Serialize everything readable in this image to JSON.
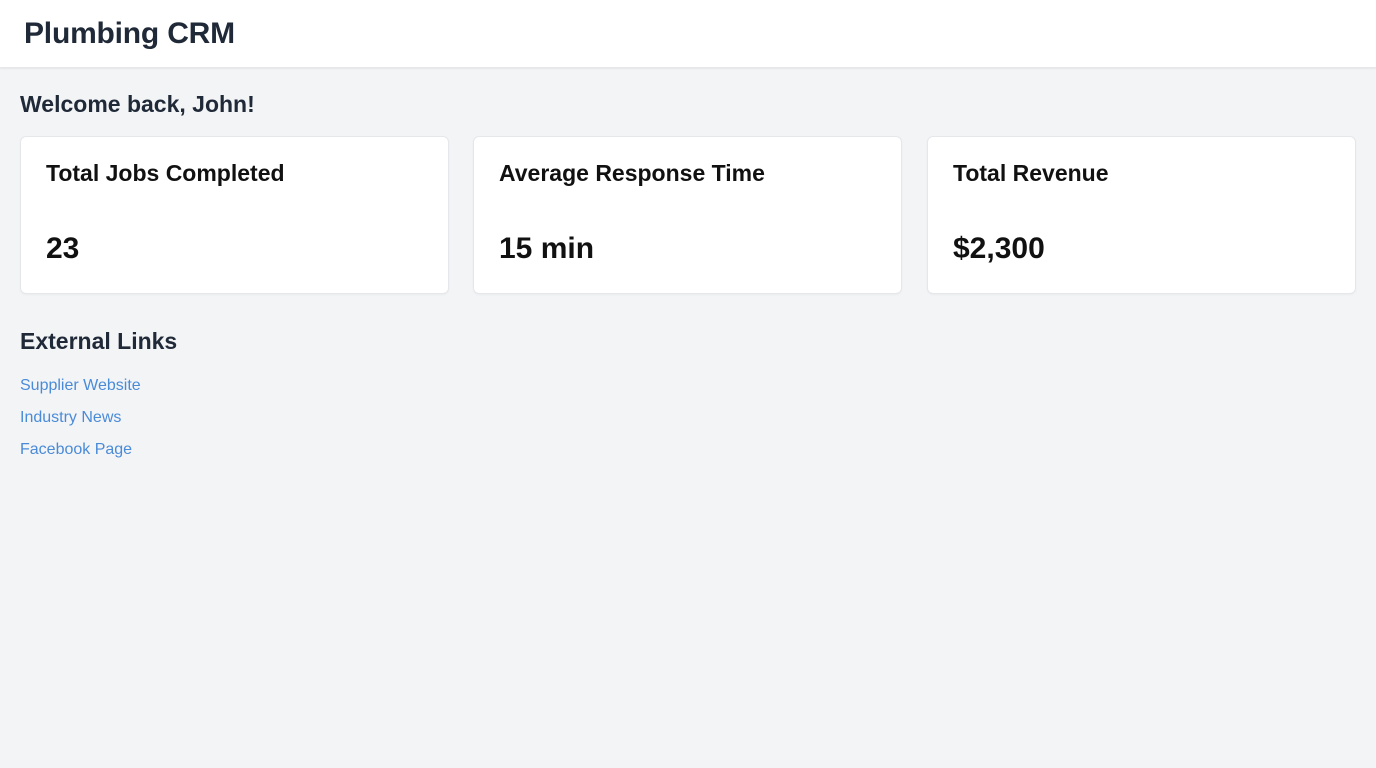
{
  "header": {
    "title": "Plumbing CRM"
  },
  "main": {
    "welcome": "Welcome back, John!",
    "stats": [
      {
        "title": "Total Jobs Completed",
        "value": "23"
      },
      {
        "title": "Average Response Time",
        "value": "15 min"
      },
      {
        "title": "Total Revenue",
        "value": "$2,300"
      }
    ],
    "links_title": "External Links",
    "links": [
      {
        "label": "Supplier Website"
      },
      {
        "label": "Industry News"
      },
      {
        "label": "Facebook Page"
      }
    ]
  },
  "colors": {
    "background": "#f3f4f6",
    "card": "#ffffff",
    "link": "#4a8bd8",
    "text": "#1f2937"
  }
}
